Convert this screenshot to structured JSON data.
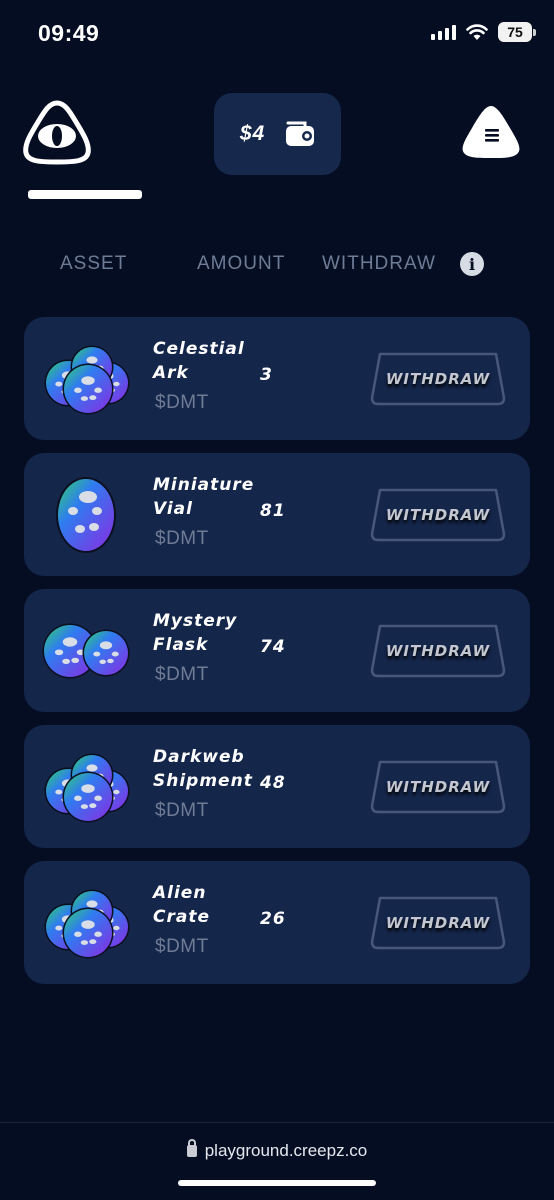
{
  "status_bar": {
    "time": "09:49",
    "battery": "75"
  },
  "header": {
    "logo_icon": "eye-triangle-logo",
    "balance": "$4",
    "wallet_icon": "wallet-icon",
    "menu_icon": "hamburger-menu-icon"
  },
  "columns": {
    "asset": "ASSET",
    "amount": "AMOUNT",
    "withdraw": "WITHDRAW",
    "info_glyph": "i"
  },
  "assets": [
    {
      "name_line1": "Celestial",
      "name_line2": "Ark",
      "ticker": "$DMT",
      "amount": "3",
      "button": "WITHDRAW",
      "icon": "orb-cluster-icon"
    },
    {
      "name_line1": "Miniature",
      "name_line2": "Vial",
      "ticker": "$DMT",
      "amount": "81",
      "button": "WITHDRAW",
      "icon": "single-orb-icon"
    },
    {
      "name_line1": "Mystery",
      "name_line2": "Flask",
      "ticker": "$DMT",
      "amount": "74",
      "button": "WITHDRAW",
      "icon": "double-orb-icon"
    },
    {
      "name_line1": "Darkweb",
      "name_line2": "Shipment",
      "ticker": "$DMT",
      "amount": "48",
      "button": "WITHDRAW",
      "icon": "orb-cluster-icon"
    },
    {
      "name_line1": "Alien",
      "name_line2": "Crate",
      "ticker": "$DMT",
      "amount": "26",
      "button": "WITHDRAW",
      "icon": "orb-cluster-icon"
    }
  ],
  "browser": {
    "url": "playground.creepz.co"
  },
  "colors": {
    "background": "#050d22",
    "card": "#15264b",
    "muted_text": "#6f7c95",
    "orb_blue": "#2f7cf0",
    "orb_purple": "#8a2be2",
    "orb_green": "#2fd36b"
  }
}
